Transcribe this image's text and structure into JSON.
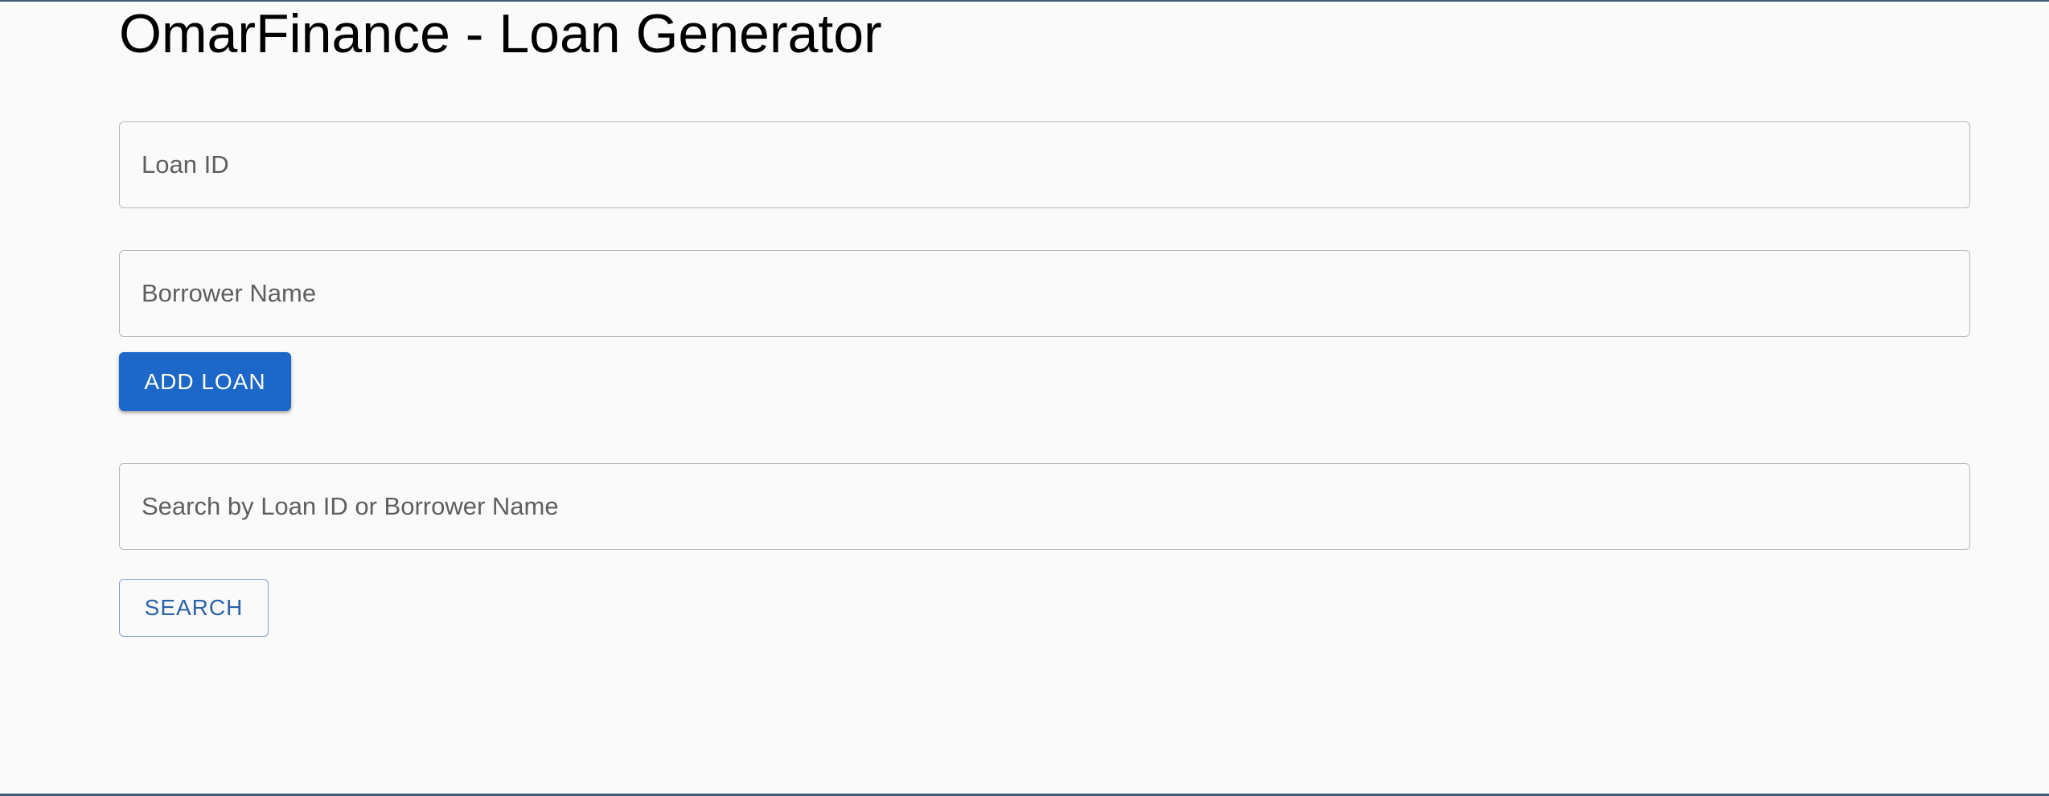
{
  "app": {
    "title": "OmarFinance - Loan Generator"
  },
  "form": {
    "loan_id": {
      "value": "",
      "placeholder": "Loan ID"
    },
    "borrower_name": {
      "value": "",
      "placeholder": "Borrower Name"
    },
    "add_button_label": "ADD LOAN"
  },
  "search": {
    "value": "",
    "placeholder": "Search by Loan ID or Borrower Name",
    "button_label": "SEARCH"
  },
  "colors": {
    "primary": "#1c67c8",
    "outline_text": "#2a62a8",
    "field_border": "#b9b9b9",
    "background": "#fafafa",
    "frame_border": "#3f5d7a"
  }
}
